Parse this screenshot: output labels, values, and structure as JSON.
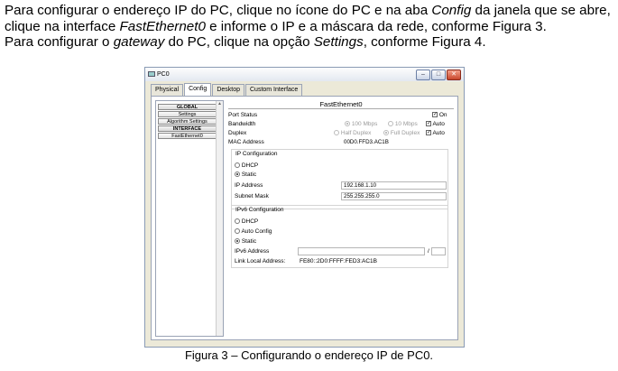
{
  "text": {
    "p1_a": "Para configurar o endereço IP do PC, clique no ícone do PC e na aba ",
    "p1_b": "Config",
    "p1_c": " da janela que se abre, clique na interface ",
    "p1_d": "FastEthernet0",
    "p1_e": " e informe o IP e a máscara da rede, conforme Figura 3.",
    "p2_a": "Para configurar o ",
    "p2_b": "gateway",
    "p2_c": " do PC, clique na opção ",
    "p2_d": "Settings",
    "p2_e": ", conforme Figura 4.",
    "caption": "Figura 3 – Configurando o endereço IP de PC0."
  },
  "window": {
    "title": "PC0",
    "min": "–",
    "max": "□",
    "close": "✕",
    "tabs": [
      "Physical",
      "Config",
      "Desktop",
      "Custom Interface"
    ],
    "active_tab": "Config"
  },
  "left": {
    "global": "GLOBAL",
    "settings": "Settings",
    "algorithm": "Algorithm Settings",
    "interface": "INTERFACE",
    "fe0": "FastEthernet0"
  },
  "panel": {
    "title": "FastEthernet0",
    "port_status_label": "Port Status",
    "port_on_label": "On",
    "bandwidth_label": "Bandwidth",
    "bw_100": "100 Mbps",
    "bw_10": "10 Mbps",
    "bw_auto": "Auto",
    "duplex_label": "Duplex",
    "half": "Half Duplex",
    "full": "Full Duplex",
    "dup_auto": "Auto",
    "mac_label": "MAC Address",
    "mac_value": "00D0.FFD3.AC1B",
    "ip_section": "IP Configuration",
    "dhcp": "DHCP",
    "static": "Static",
    "ip_label": "IP Address",
    "ip_value": "192.168.1.10",
    "mask_label": "Subnet Mask",
    "mask_value": "255.255.255.0",
    "ipv6_section": "IPv6 Configuration",
    "dhcp6": "DHCP",
    "autoconfig": "Auto Config",
    "static6": "Static",
    "ipv6_label": "IPv6 Address",
    "ipv6_slash": "/",
    "lla_label": "Link Local Address:",
    "lla_value": "FE80::2D0:FFFF:FED3:AC1B"
  }
}
